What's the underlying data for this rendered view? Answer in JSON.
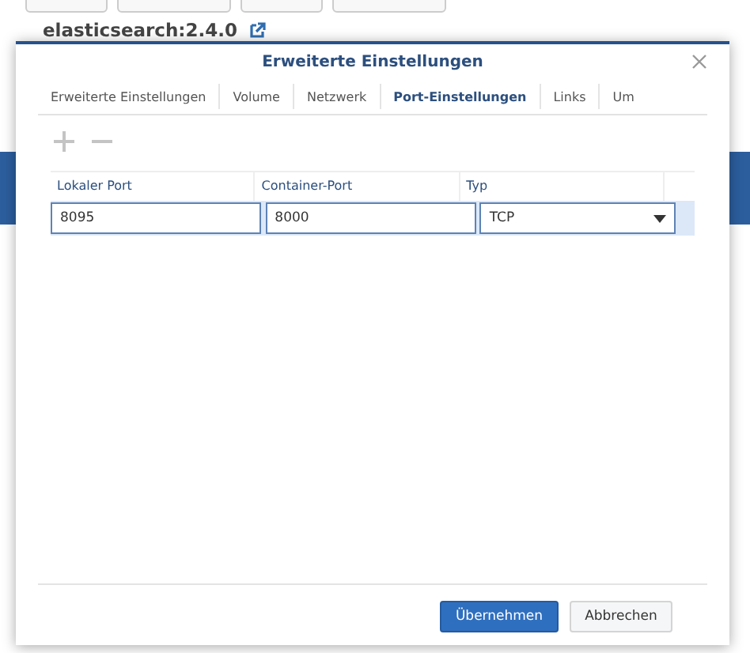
{
  "page": {
    "title": "elasticsearch:2.4.0"
  },
  "dialog": {
    "title": "Erweiterte Einstellungen",
    "tabs": [
      {
        "label": "Erweiterte Einstellungen",
        "selected": false
      },
      {
        "label": "Volume",
        "selected": false
      },
      {
        "label": "Netzwerk",
        "selected": false
      },
      {
        "label": "Port-Einstellungen",
        "selected": true
      },
      {
        "label": "Links",
        "selected": false
      },
      {
        "label": "Um",
        "selected": false
      }
    ],
    "columns": [
      "Lokaler Port",
      "Container-Port",
      "Typ"
    ],
    "rows": [
      {
        "local_port": "8095",
        "container_port": "8000",
        "type": "TCP",
        "selected": true
      }
    ],
    "buttons": [
      {
        "label": "Übernehmen",
        "kind": "primary"
      },
      {
        "label": "Abbrechen",
        "kind": "secondary"
      }
    ]
  }
}
